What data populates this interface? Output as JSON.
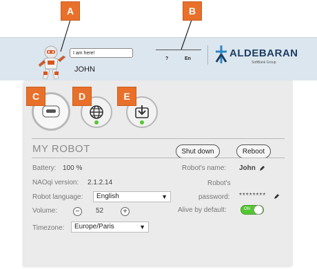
{
  "callouts": {
    "a": "A",
    "b": "B",
    "c": "C",
    "d": "D",
    "e": "E",
    "color": "#e8702a"
  },
  "header": {
    "speech_bubble": "I am here!",
    "robot_name": "JOHN",
    "help_label": "?",
    "language_label": "En",
    "brand": "ALDEBARAN",
    "brand_sub": "SoftBank Group"
  },
  "app_icons": [
    {
      "name": "robot-settings-icon",
      "active": true
    },
    {
      "name": "globe-icon",
      "status": "green"
    },
    {
      "name": "download-icon",
      "status": "green"
    }
  ],
  "my_robot": {
    "title": "MY ROBOT",
    "shutdown_label": "Shut down",
    "reboot_label": "Reboot",
    "battery_label": "Battery:",
    "battery_value": "100 %",
    "naoqi_label": "NAOqi version:",
    "naoqi_value": "2.1.2.14",
    "language_label": "Robot language:",
    "language_value": "English",
    "volume_label": "Volume:",
    "volume_minus": "−",
    "volume_value": "52",
    "volume_plus": "+",
    "timezone_label": "Timezone:",
    "timezone_value": "Europe/Paris",
    "robot_name_label": "Robot's name:",
    "robot_name_value": "John",
    "password_label_1": "Robot's",
    "password_label_2": "password:",
    "password_value": "********",
    "alive_label": "Alive by default:",
    "alive_toggle": "ON"
  },
  "colors": {
    "accent": "#e8702a",
    "status_green": "#55c633",
    "brand_blue": "#1c3e62",
    "header_bg": "#dce6ee"
  }
}
